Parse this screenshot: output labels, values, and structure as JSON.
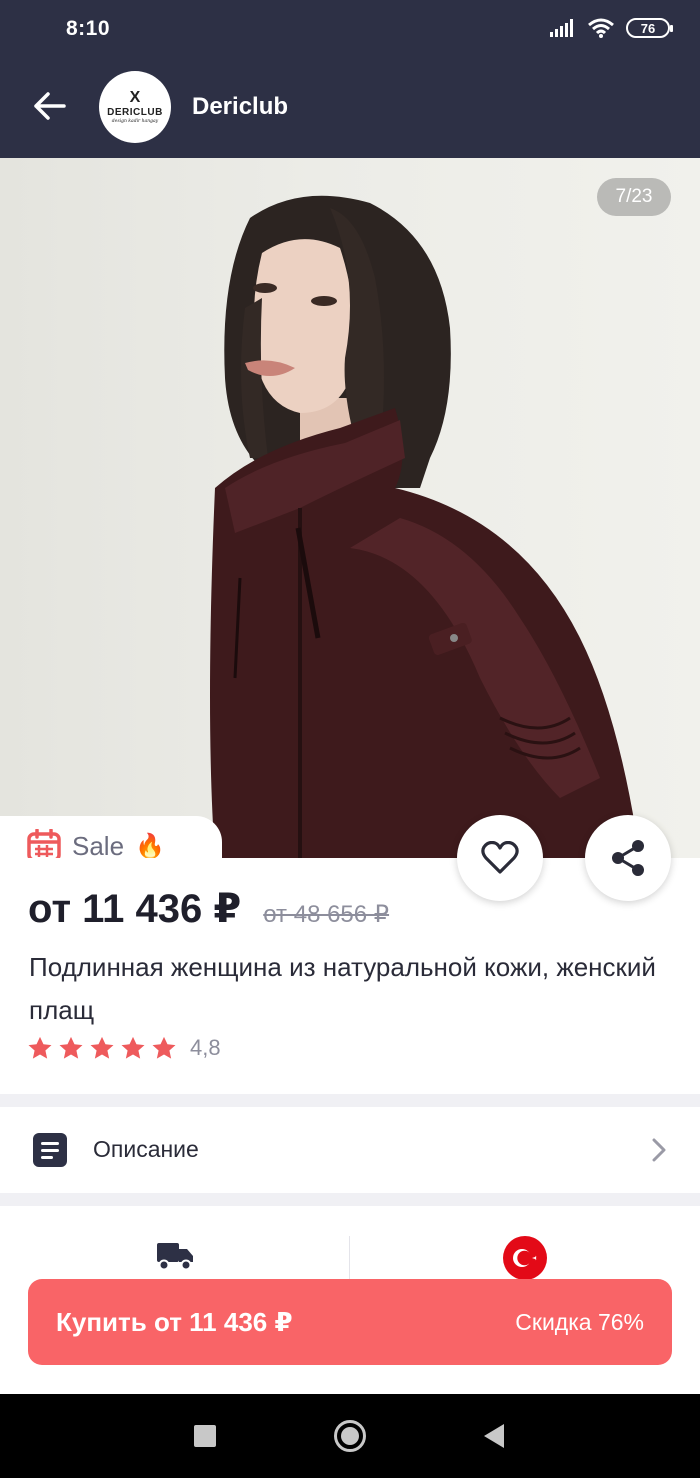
{
  "status_bar": {
    "time": "8:10",
    "battery": "76"
  },
  "header": {
    "store_name": "Dericlub",
    "logo": {
      "mark": "X",
      "word": "DERICLUB",
      "tagline": "design kadir hangay"
    }
  },
  "gallery": {
    "counter": "7/23"
  },
  "sale": {
    "label": "Sale",
    "emoji": "🔥"
  },
  "product": {
    "price": "от 11 436 ₽",
    "old_price": "от 48 656 ₽",
    "title": "Подлинная женщина из натуральной кожи, женский плащ",
    "rating": "4,8",
    "rating_value": 4.8,
    "stars_max": 5
  },
  "description_row": {
    "label": "Описание"
  },
  "buy_button": {
    "label": "Купить от 11 436 ₽",
    "discount": "Скидка 76%"
  },
  "colors": {
    "header_bg": "#2d3045",
    "accent": "#f96467",
    "star": "#ee5a5c"
  }
}
